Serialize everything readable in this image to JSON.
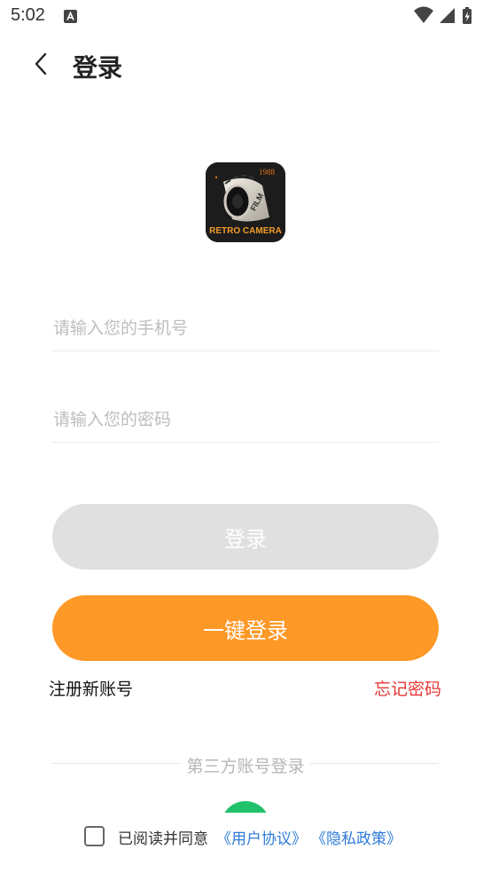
{
  "status_bar": {
    "time": "5:02",
    "notification_icon": "a-notification-icon",
    "icons": [
      "wifi-icon",
      "signal-icon",
      "battery-charging-icon"
    ]
  },
  "header": {
    "back_icon": "chevron-left-icon",
    "title": "登录"
  },
  "logo": {
    "year": "1988",
    "film_label": "FILM",
    "caption": "RETRO CAMERA"
  },
  "form": {
    "phone_placeholder": "请输入您的手机号",
    "phone_value": "",
    "password_placeholder": "请输入您的密码",
    "password_value": ""
  },
  "buttons": {
    "login_label": "登录",
    "quick_login_label": "一键登录"
  },
  "links": {
    "register": "注册新账号",
    "forgot_password": "忘记密码"
  },
  "third_party": {
    "label": "第三方账号登录",
    "icon": "wechat-icon"
  },
  "agreement": {
    "checked": false,
    "text": "已阅读并同意",
    "user_agreement": "《用户协议》",
    "privacy_policy": "《隐私政策》"
  },
  "colors": {
    "accent": "#fe9826",
    "login_disabled": "#e0e0e0",
    "forgot_link": "#e53935",
    "agreement_link": "#2e7bd8",
    "wechat": "#21c16b"
  }
}
